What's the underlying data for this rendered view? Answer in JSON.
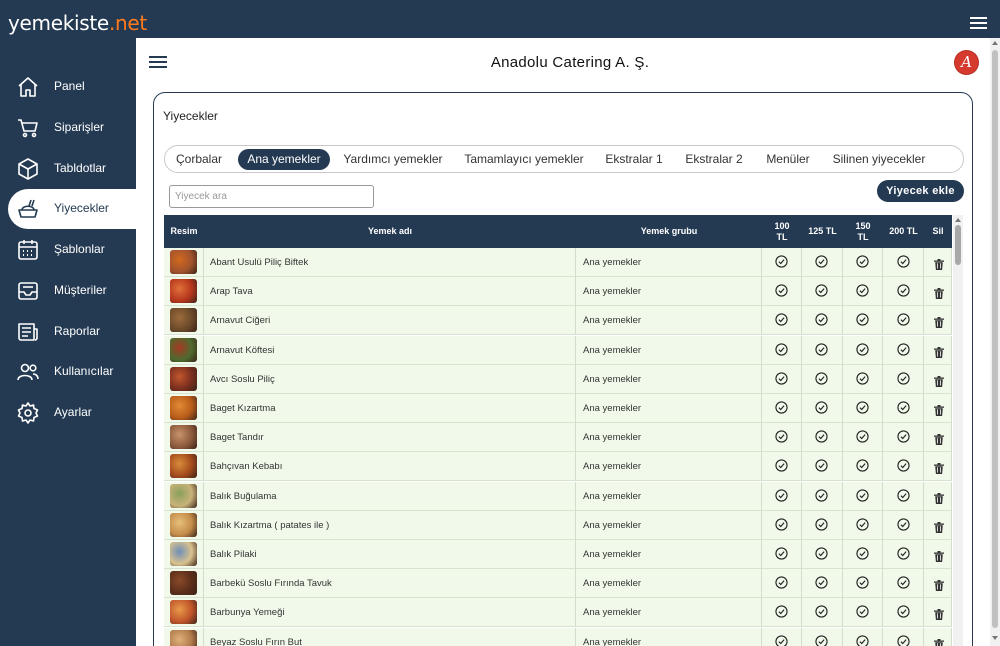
{
  "brand": {
    "name": "yemekiste",
    "tld": ".net"
  },
  "company": "Anadolu Catering A. Ş.",
  "avatar_letter": "A",
  "sidebar": {
    "items": [
      {
        "label": "Panel",
        "icon": "home-icon"
      },
      {
        "label": "Siparişler",
        "icon": "cart-icon"
      },
      {
        "label": "Tabldotlar",
        "icon": "box-icon"
      },
      {
        "label": "Yiyecekler",
        "icon": "food-icon",
        "active": true
      },
      {
        "label": "Şablonlar",
        "icon": "calendar-icon"
      },
      {
        "label": "Müşteriler",
        "icon": "inbox-icon"
      },
      {
        "label": "Raporlar",
        "icon": "newspaper-icon"
      },
      {
        "label": "Kullanıcılar",
        "icon": "users-icon"
      },
      {
        "label": "Ayarlar",
        "icon": "gear-icon"
      }
    ]
  },
  "card": {
    "title": "Yiyecekler"
  },
  "tabs": [
    "Çorbalar",
    "Ana yemekler",
    "Yardımcı yemekler",
    "Tamamlayıcı yemekler",
    "Ekstralar 1",
    "Ekstralar 2",
    "Menüler",
    "Silinen yiyecekler"
  ],
  "active_tab": "Ana yemekler",
  "search": {
    "placeholder": "Yiyecek ara",
    "value": ""
  },
  "add_button": "Yiyecek ekle",
  "table": {
    "headers": {
      "image": "Resim",
      "name": "Yemek adı",
      "group": "Yemek grubu",
      "p100": "100 TL",
      "p125": "125 TL",
      "p150": "150 TL",
      "p200": "200 TL",
      "delete": "Sil"
    },
    "rows": [
      {
        "name": "Abant Usulü Piliç Biftek",
        "group": "Ana yemekler"
      },
      {
        "name": "Arap Tava",
        "group": "Ana yemekler"
      },
      {
        "name": "Arnavut Ciğeri",
        "group": "Ana yemekler"
      },
      {
        "name": "Arnavut Köftesi",
        "group": "Ana yemekler"
      },
      {
        "name": "Avcı Soslu Piliç",
        "group": "Ana yemekler"
      },
      {
        "name": "Baget Kızartma",
        "group": "Ana yemekler"
      },
      {
        "name": "Baget Tandır",
        "group": "Ana yemekler"
      },
      {
        "name": "Bahçıvan Kebabı",
        "group": "Ana yemekler"
      },
      {
        "name": "Balık Buğulama",
        "group": "Ana yemekler"
      },
      {
        "name": "Balık Kızartma ( patates ile )",
        "group": "Ana yemekler"
      },
      {
        "name": "Balık Pilaki",
        "group": "Ana yemekler"
      },
      {
        "name": "Barbekü Soslu Fırında Tavuk",
        "group": "Ana yemekler"
      },
      {
        "name": "Barbunya Yemeği",
        "group": "Ana yemekler"
      },
      {
        "name": "Beyaz Soslu Fırın But",
        "group": "Ana yemekler"
      }
    ]
  },
  "colors": {
    "navy": "#243a52",
    "accent": "#ff7a1a",
    "row_bg": "#f1faea",
    "avatar": "#d63a2e"
  }
}
